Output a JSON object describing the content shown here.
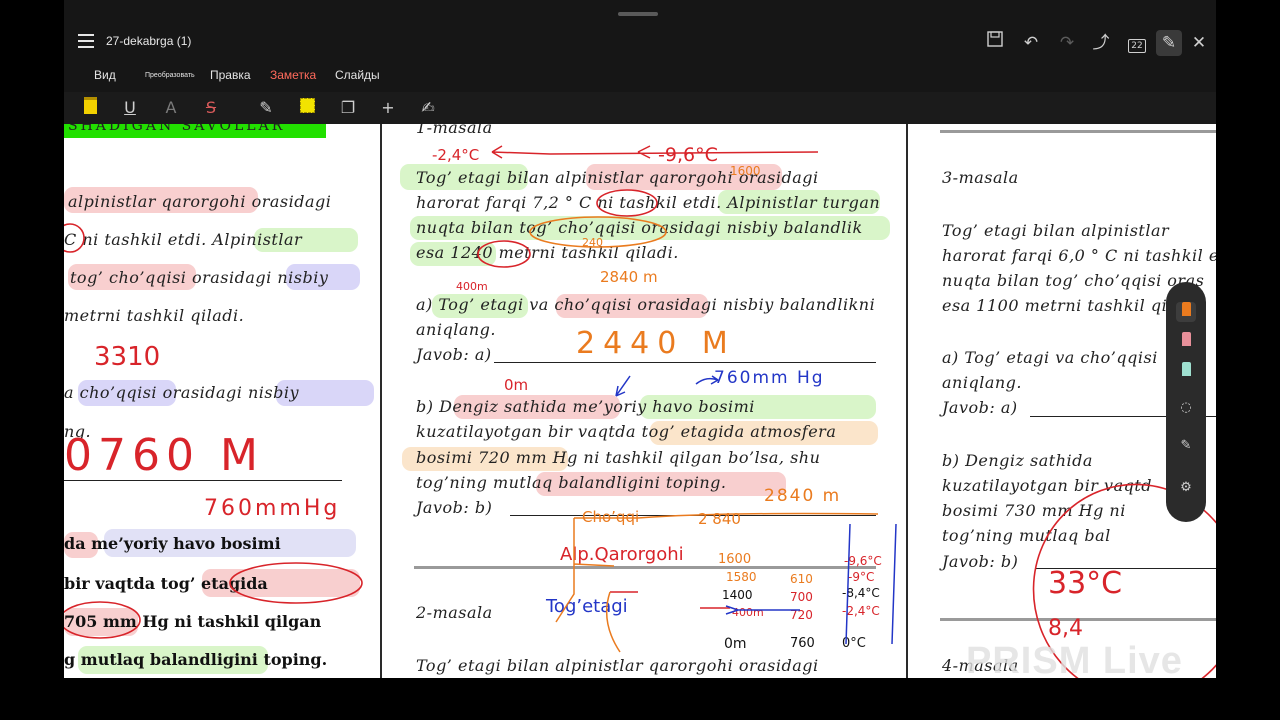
{
  "window": {
    "title": "27-dekabrga (1)",
    "page_count": "22"
  },
  "tabs": [
    {
      "label": "Вид"
    },
    {
      "label": "Преобразовать"
    },
    {
      "label": "Правка"
    },
    {
      "label": "Заметка",
      "active": true
    },
    {
      "label": "Слайды"
    }
  ],
  "colors": {
    "accent": "#ff6a5c",
    "annotation_red": "#d8242a",
    "annotation_orange": "#ea7b1f",
    "annotation_blue": "#2336c7"
  },
  "toolbar_icons": [
    "save-icon",
    "undo-icon",
    "redo-icon",
    "share-icon",
    "page-count-icon",
    "pen-edit-icon",
    "close-icon"
  ],
  "annotation_tools": [
    "highlighter-yellow-icon",
    "underline-icon",
    "text-color-icon",
    "strikethrough-icon",
    "eraser-icon",
    "area-highlight-icon",
    "shapes-icon",
    "add-icon",
    "signature-pen-icon"
  ],
  "left_page": {
    "header": "SHADIGAN SAVOLLAR",
    "lines": [
      "alpinistlar  qarorgohi   orasidagi",
      "C  ni  tashkil  etdi.  Alpinistlar",
      "tog’  cho’qqisi   orasidagi  nisbiy",
      "metrni tashkil qiladi.",
      "a  cho’qqisi  orasidagi  nisbiy",
      "ng.",
      "da  me’yoriy  havo  bosimi",
      "bir   vaqtda   tog’   etagida",
      "705 mm Hg ni tashkil qilgan",
      "g mutlaq balandligini toping."
    ],
    "hand_notes": [
      "3310",
      "0760 M",
      "760mmHg"
    ]
  },
  "middle_page": {
    "heading": "1-masala",
    "paragraph": [
      "Tog’  etagi   bilan   alpinistlar   qarorgohi   orasidagi",
      "harorat farqi 7,2 ° C ni tashkil etdi. Alpinistlar turgan",
      "nuqta  bilan  tog’  cho’qqisi  orasidagi  nisbiy  balandlik",
      "esa 1240 metrni tashkil qiladi."
    ],
    "question_a": [
      "a) Tog’ etagi va cho’qqisi orasidagi nisbiy balandlikni",
      "aniqlang."
    ],
    "answer_a_label": "Javob: a)",
    "question_b": [
      "b)    Dengiz     sathida     me’yoriy     havo     bosimi",
      "kuzatilayotgan  bir  vaqtda  tog’  etagida  atmosfera",
      "bosimi  720  mm  Hg  ni  tashkil  qilgan  bo’lsa,  shu",
      "tog’ning          mutlaq          balandligini          toping."
    ],
    "answer_b_label": "Javob: b)",
    "heading2": "2-masala",
    "paragraph2_first": "Tog’   etagi   bilan   alpinistlar   qarorgohi   orasidagi",
    "hand_notes": {
      "temps_top": "-2,4°C",
      "temps_top_right": "-9,6°C",
      "note_1600": "1600",
      "note_2840_small": "2840 m",
      "note_400m": "400m",
      "note_240": "240",
      "answer_a": "2440 M",
      "zero_m": "0m",
      "pressure": "760mm Hg",
      "answer_b": "2840 m",
      "summit": "Cho’qqi",
      "summit_height": "2 840",
      "camp": "Alp.Qarorgohi",
      "camp_height": "1600",
      "base": "Tog’etagi",
      "table_left": [
        "1580",
        "1400",
        "400m",
        "0m"
      ],
      "table_mid": [
        "610",
        "700",
        "720",
        "760"
      ],
      "table_right": [
        "-9,6°C",
        "-9°C",
        "-8,4°C",
        "-2,4°C",
        "0°C"
      ]
    }
  },
  "right_page": {
    "heading": "3-masala",
    "paragraph": [
      "Tog’  etagi   bilan   alpinistlar",
      "harorat farqi 6,0 ° C ni tashkil e",
      "nuqta bilan tog’ cho’qqisi oras",
      "esa 1100 metrni tashkil qil"
    ],
    "question_a": [
      "a) Tog’ etagi va cho’qqisi",
      "aniqlang."
    ],
    "answer_a_label": "Javob: a)",
    "question_b": [
      "b)     Dengiz     sathida",
      "kuzatilayotgan  bir  vaqtd",
      "bosimi  730  mm  Hg  ni",
      "tog’ning         mutlaq         bal"
    ],
    "answer_b_label": "Javob: b)",
    "heading4": "4-masala",
    "hand_notes": [
      "33°C",
      "8,4"
    ]
  },
  "side_panel_tools": [
    "marker-orange-icon",
    "eraser-pink-icon",
    "highlighter-teal-icon",
    "lasso-icon",
    "pen-icon",
    "settings-icon"
  ],
  "watermark": "PRISM Live"
}
